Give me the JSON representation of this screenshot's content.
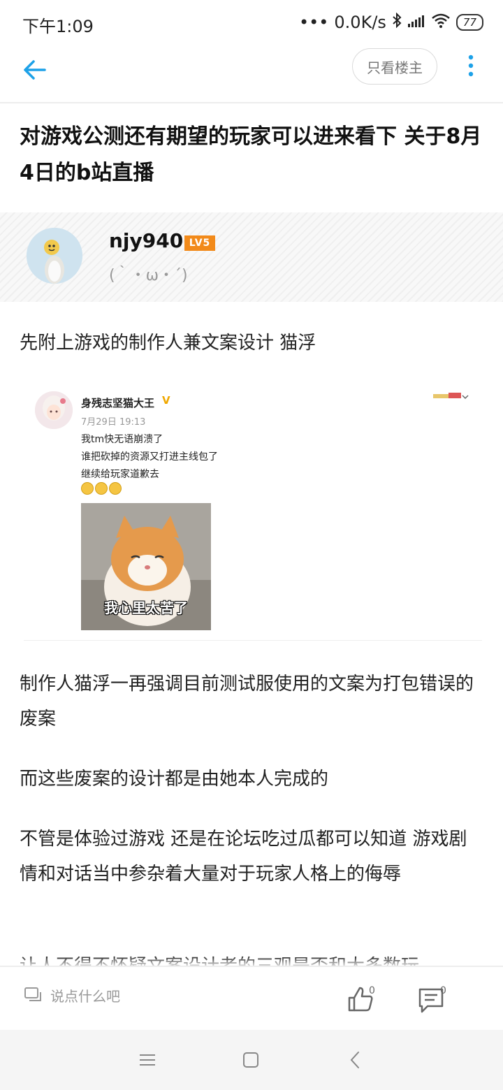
{
  "status": {
    "time": "下午1:09",
    "network_speed": "0.0K/s",
    "battery": "77"
  },
  "header": {
    "only_op_label": "只看楼主"
  },
  "post": {
    "title": "对游戏公测还有期望的玩家可以进来看下 关于8月4日的b站直播",
    "author": {
      "name": "njy940",
      "level": "LV5",
      "signature": "(｀・ω・´)"
    },
    "paragraphs": [
      "先附上游戏的制作人兼文案设计 猫浮",
      "制作人猫浮一再强调目前测试服使用的文案为打包错误的废案",
      "而这些废案的设计都是由她本人完成的",
      "不管是体验过游戏 还是在论坛吃过瓜都可以知道 游戏剧情和对话当中参杂着大量对于玩家人格上的侮辱",
      "让人不得不怀疑文案设计者的三观是否和大多数玩"
    ]
  },
  "embed": {
    "name": "身残志坚猫大王",
    "verified": "V",
    "date": "7月29日 19:13",
    "lines": [
      "我tm快无语崩溃了",
      "谁把砍掉的资源又打进主线包了",
      "继续给玩家道歉去"
    ],
    "image_caption": "我心里太苦了"
  },
  "footer": {
    "comment_placeholder": "说点什么吧",
    "like_count": "0",
    "comment_count": "0"
  },
  "colors": {
    "accent": "#1da1e8",
    "level_badge": "#f28a1a"
  }
}
